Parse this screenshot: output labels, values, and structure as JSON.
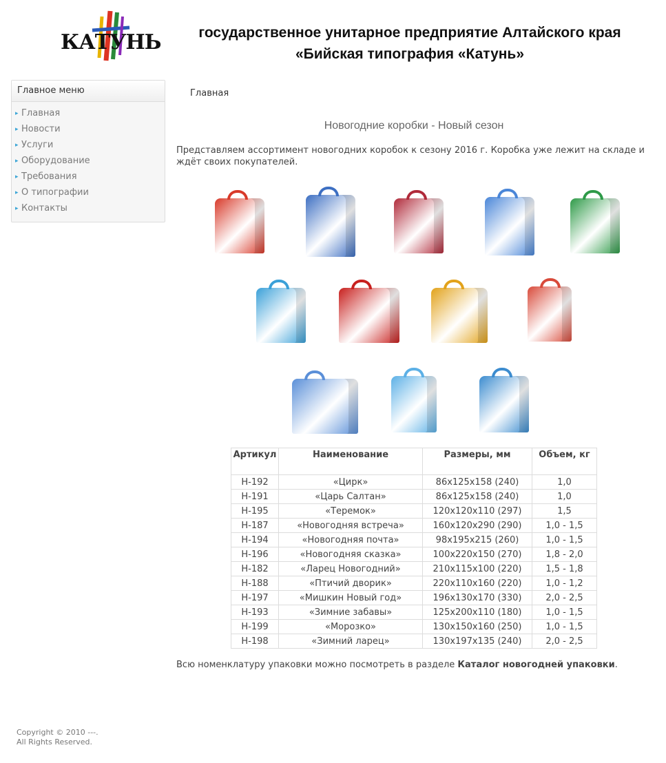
{
  "header": {
    "logo_text": "КАТУНЬ",
    "title_line1": "государственное унитарное предприятие Алтайского края",
    "title_line2": "«Бийская типография «Катунь»"
  },
  "sidebar": {
    "title": "Главное меню",
    "items": [
      {
        "label": "Главная"
      },
      {
        "label": "Новости"
      },
      {
        "label": "Услуги"
      },
      {
        "label": "Оборудование"
      },
      {
        "label": "Требования"
      },
      {
        "label": "О типографии"
      },
      {
        "label": "Контакты"
      }
    ]
  },
  "breadcrumb": "Главная",
  "article": {
    "title": "Новогодние коробки - Новый сезон",
    "intro": "Представляем ассортимент новогодних коробок к сезону 2016 г. Коробка уже лежит на складе и ждёт своих покупателей.",
    "footer_prefix": "Всю номенклатуру упаковки можно посмотреть в разделе ",
    "footer_link": "Каталог новогодней упаковки",
    "footer_suffix": "."
  },
  "gallery": {
    "colors": [
      "#d83a2a",
      "#3d6fc2",
      "#b02a3a",
      "#4a86d8",
      "#2e9a48",
      "#3aa0d8",
      "#c8201e",
      "#e2a21a",
      "#d84a3a",
      "#5a8fd8",
      "#5cb0e6",
      "#3c8ccf"
    ]
  },
  "table": {
    "headers": [
      "Артикул",
      "Наименование",
      "Размеры, мм",
      "Объем, кг"
    ],
    "rows": [
      [
        "Н-192",
        "«Цирк»",
        "86х125х158 (240)",
        "1,0"
      ],
      [
        "Н-191",
        "«Царь Салтан»",
        "86х125х158 (240)",
        "1,0"
      ],
      [
        "Н-195",
        "«Теремок»",
        "120х120х110 (297)",
        "1,5"
      ],
      [
        "Н-187",
        "«Новогодняя встреча»",
        "160х120х290 (290)",
        "1,0 - 1,5"
      ],
      [
        "Н-194",
        "«Новогодняя почта»",
        "98х195х215 (260)",
        "1,0 - 1,5"
      ],
      [
        "Н-196",
        "«Новогодняя сказка»",
        "100х220х150 (270)",
        "1,8 - 2,0"
      ],
      [
        "Н-182",
        "«Ларец Новогодний»",
        "210х115х100 (220)",
        "1,5 - 1,8"
      ],
      [
        "Н-188",
        "«Птичий дворик»",
        "220х110х160 (220)",
        "1,0 - 1,2"
      ],
      [
        "Н-197",
        "«Мишкин Новый год»",
        "196х130х170 (330)",
        "2,0 - 2,5"
      ],
      [
        "Н-193",
        "«Зимние забавы»",
        "125х200х110 (180)",
        "1,0 - 1,5"
      ],
      [
        "Н-199",
        "«Морозко»",
        "130х150х160 (250)",
        "1,0 - 1,5"
      ],
      [
        "Н-198",
        "«Зимний ларец»",
        "130х197х135 (240)",
        "2,0 - 2,5"
      ]
    ]
  },
  "footer": {
    "copyright_line1": "Copyright © 2010 ---.",
    "copyright_line2": "All Rights Reserved."
  }
}
